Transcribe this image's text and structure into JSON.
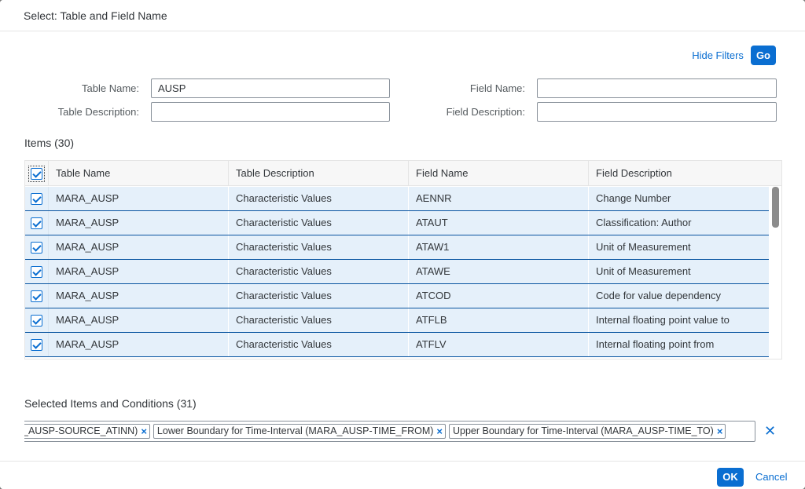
{
  "dialog": {
    "title": "Select: Table and Field Name"
  },
  "filterbar": {
    "hide_filters_label": "Hide Filters",
    "go_label": "Go",
    "table_name_label": "Table Name:",
    "table_name_value": "AUSP",
    "field_name_label": "Field Name:",
    "field_name_value": "",
    "table_description_label": "Table Description:",
    "table_description_value": "",
    "field_description_label": "Field Description:",
    "field_description_value": ""
  },
  "items": {
    "title": "Items (30)",
    "columns": [
      "Table Name",
      "Table Description",
      "Field Name",
      "Field Description"
    ],
    "rows": [
      [
        "MARA_AUSP",
        "Characteristic Values",
        "AENNR",
        "Change Number"
      ],
      [
        "MARA_AUSP",
        "Characteristic Values",
        "ATAUT",
        "Classification: Author"
      ],
      [
        "MARA_AUSP",
        "Characteristic Values",
        "ATAW1",
        "Unit of Measurement"
      ],
      [
        "MARA_AUSP",
        "Characteristic Values",
        "ATAWE",
        "Unit of Measurement"
      ],
      [
        "MARA_AUSP",
        "Characteristic Values",
        "ATCOD",
        "Code for value dependency"
      ],
      [
        "MARA_AUSP",
        "Characteristic Values",
        "ATFLB",
        "Internal floating point value to"
      ],
      [
        "MARA_AUSP",
        "Characteristic Values",
        "ATFLV",
        "Internal floating point from"
      ]
    ]
  },
  "selected": {
    "title": "Selected Items and Conditions (31)",
    "tokens": [
      "_AUSP-SOURCE_ATINN)",
      "Lower Boundary for Time-Interval (MARA_AUSP-TIME_FROM)",
      "Upper Boundary for Time-Interval (MARA_AUSP-TIME_TO)"
    ],
    "token_remove_glyph": "×",
    "clear_all_glyph": "✕"
  },
  "footer": {
    "ok_label": "OK",
    "cancel_label": "Cancel"
  },
  "colors": {
    "accent": "#0a6ed1",
    "row_selected": "#e5f0fa",
    "row_border": "#0854a0"
  }
}
